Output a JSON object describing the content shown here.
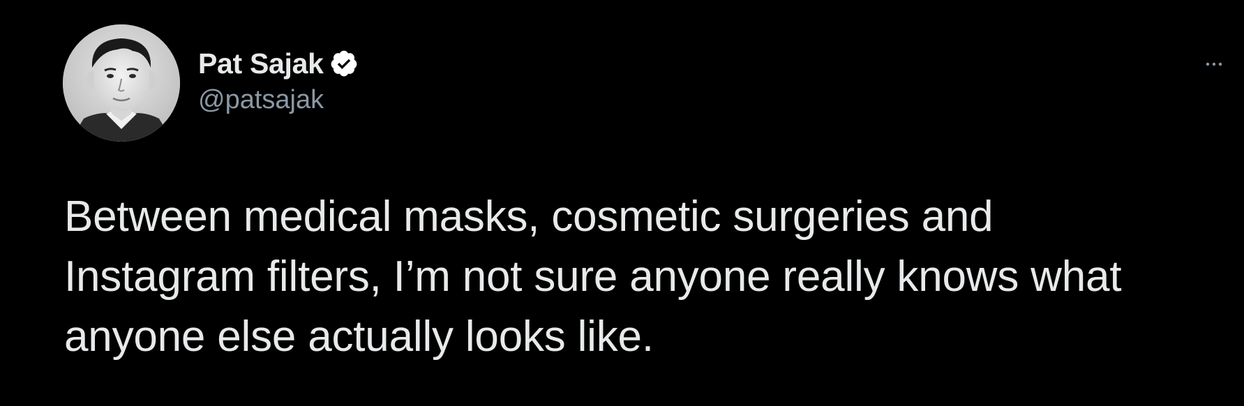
{
  "tweet": {
    "author": {
      "display_name": "Pat Sajak",
      "handle": "@patsajak",
      "verified": true
    },
    "text": "Between medical masks, cosmetic surgeries and\nInstagram filters, I’m not sure anyone really knows what\nanyone else actually looks like.",
    "more_icon": "more-options-icon"
  },
  "colors": {
    "background": "#000000",
    "primary_text": "#e7e9ea",
    "secondary_text": "#8b98a5",
    "verified_badge": "#ffffff"
  }
}
